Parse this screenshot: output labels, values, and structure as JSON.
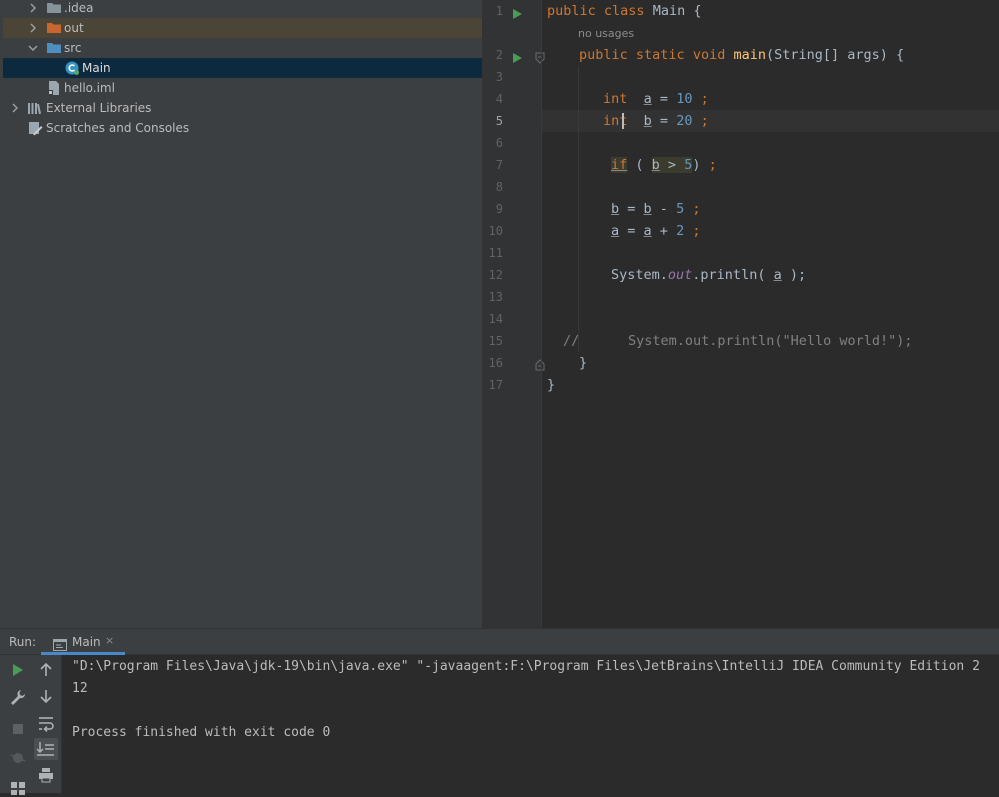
{
  "project_tree": {
    "items": [
      {
        "label": ".idea",
        "icon": "folder-icon",
        "expanded": false
      },
      {
        "label": "out",
        "icon": "folder-orange-icon",
        "expanded": false
      },
      {
        "label": "src",
        "icon": "folder-blue-icon",
        "expanded": true
      },
      {
        "label": "Main",
        "icon": "java-class-icon"
      },
      {
        "label": "hello.iml",
        "icon": "iml-file-icon"
      },
      {
        "label": "External Libraries",
        "icon": "libraries-icon",
        "expanded": false
      },
      {
        "label": "Scratches and Consoles",
        "icon": "scratches-icon"
      }
    ]
  },
  "editor": {
    "current_line": 5,
    "hint_no_usages": "no usages",
    "line_numbers": [
      "1",
      "2",
      "3",
      "4",
      "5",
      "6",
      "7",
      "8",
      "9",
      "10",
      "11",
      "12",
      "13",
      "14",
      "15",
      "16",
      "17"
    ],
    "lines": {
      "l1": {
        "kw1": "public",
        "kw2": "class",
        "rest": " Main {"
      },
      "l2": {
        "kw1": "public",
        "kw2": "static",
        "kw3": "void",
        "fn": "main",
        "rest": "(String[] args) {"
      },
      "l4": {
        "kw": "int",
        "var": "a",
        "op": " = ",
        "num": "10",
        "semi": " ;"
      },
      "l5": {
        "kw": "int",
        "var": "b",
        "op": " = ",
        "num": "20",
        "semi": " ;"
      },
      "l7": {
        "kw": "if",
        "open": " ( ",
        "var": "b",
        "op": " > ",
        "num": "5",
        "close": ") ",
        "semi": ";"
      },
      "l9": {
        "var1": "b",
        "op1": " = ",
        "var2": "b",
        "op2": " - ",
        "num": "5",
        "semi": " ;"
      },
      "l10": {
        "var1": "a",
        "op1": " = ",
        "var2": "a",
        "op2": " + ",
        "num": "2",
        "semi": " ;"
      },
      "l12": {
        "pre": "System.",
        "static": "out",
        "post": ".println( ",
        "var": "a",
        "close": " );"
      },
      "l15": {
        "comment": "//      System.out.println(\"Hello world!\");"
      },
      "l16": {
        "text": "}"
      },
      "l17": {
        "text": "}"
      }
    }
  },
  "run_window": {
    "label": "Run:",
    "tab_label": "Main",
    "close_glyph": "×",
    "console_lines": [
      "\"D:\\Program Files\\Java\\jdk-19\\bin\\java.exe\" \"-javaagent:F:\\Program Files\\JetBrains\\IntelliJ IDEA Community Edition 2",
      "12",
      "",
      "Process finished with exit code 0"
    ]
  }
}
